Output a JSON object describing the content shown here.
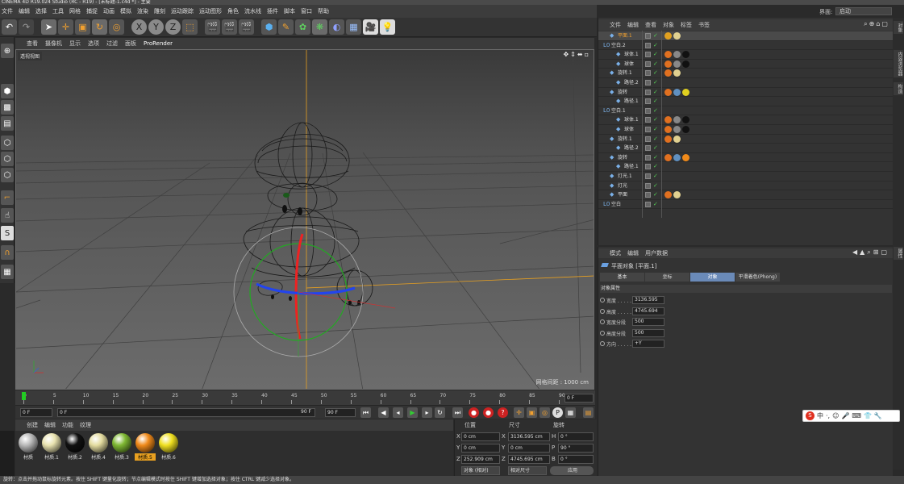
{
  "window": {
    "title": "CINEMA 4D R19.024 Studio (RC - R19) - [未标题-1.c4d *] - 主要"
  },
  "menu": [
    "文件",
    "编辑",
    "选择",
    "工具",
    "网格",
    "捕捉",
    "动画",
    "模拟",
    "渲染",
    "雕刻",
    "运动跟踪",
    "运动图形",
    "角色",
    "流水线",
    "插件",
    "脚本",
    "窗口",
    "帮助"
  ],
  "layout": {
    "label": "界面:",
    "value": "启动"
  },
  "viewport": {
    "menu": [
      "查看",
      "摄像机",
      "显示",
      "选项",
      "过滤",
      "面板",
      "ProRender"
    ],
    "name": "透视视图",
    "grid_info": "网格间距 : 1000 cm",
    "nav_icons": "✥⇕⬌▫"
  },
  "timeline": {
    "ticks": [
      "0",
      "5",
      "10",
      "15",
      "20",
      "25",
      "30",
      "35",
      "40",
      "45",
      "50",
      "55",
      "60",
      "65",
      "70",
      "75",
      "80",
      "85",
      "90"
    ],
    "end_frame_display": "0 F",
    "current_frame": "0 F",
    "start": "0 F",
    "range_end": "90 F",
    "max": "90 F"
  },
  "material_menu": [
    "创建",
    "编辑",
    "功能",
    "纹理"
  ],
  "materials": [
    {
      "name": "材质",
      "color": "#b9b9b9",
      "selected": false
    },
    {
      "name": "材质.1",
      "color": "#e9e3b0",
      "selected": false
    },
    {
      "name": "材质.2",
      "color": "#111111",
      "selected": false
    },
    {
      "name": "材质.4",
      "color": "#e4dca0",
      "selected": false
    },
    {
      "name": "材质.3",
      "color": "#7fb833",
      "selected": false
    },
    {
      "name": "材质.5",
      "color": "#f08a1a",
      "selected": true
    },
    {
      "name": "材质.6",
      "color": "#f0e020",
      "selected": false
    }
  ],
  "coords": {
    "headers": [
      "位置",
      "尺寸",
      "旋转"
    ],
    "rows": [
      {
        "axis": "X",
        "pos": "0 cm",
        "size_axis": "X",
        "size": "3136.595 cm",
        "rot_axis": "H",
        "rot": "0 °"
      },
      {
        "axis": "Y",
        "pos": "0 cm",
        "size_axis": "Y",
        "size": "0 cm",
        "rot_axis": "P",
        "rot": "90 °"
      },
      {
        "axis": "Z",
        "pos": "252.909 cm",
        "size_axis": "Z",
        "size": "4745.695 cm",
        "rot_axis": "B",
        "rot": "0 °"
      }
    ],
    "mode": "对象 (相对)",
    "size_mode": "相对尺寸",
    "apply": "应用"
  },
  "objects": {
    "menu": [
      "文件",
      "编辑",
      "查看",
      "对象",
      "标签",
      "书签"
    ],
    "rows": [
      {
        "name": "平面.1",
        "indent": 1,
        "selected": true,
        "tags": [
          "#e0a020",
          "#e0d090"
        ]
      },
      {
        "name": "空白.2",
        "indent": 0,
        "selected": false,
        "tags": []
      },
      {
        "name": "球体.1",
        "indent": 2,
        "selected": false,
        "tags": [
          "#e07020",
          "#888888",
          "#111111"
        ]
      },
      {
        "name": "球体",
        "indent": 2,
        "selected": false,
        "tags": [
          "#e07020",
          "#888888",
          "#111111"
        ]
      },
      {
        "name": "旋转.1",
        "indent": 1,
        "selected": false,
        "tags": [
          "#e07020",
          "#e0d090"
        ]
      },
      {
        "name": "路径.2",
        "indent": 2,
        "selected": false,
        "tags": []
      },
      {
        "name": "旋转",
        "indent": 1,
        "selected": false,
        "tags": [
          "#e07020",
          "#6090c0",
          "#e0d020"
        ]
      },
      {
        "name": "路径.1",
        "indent": 2,
        "selected": false,
        "tags": []
      },
      {
        "name": "空白.1",
        "indent": 0,
        "selected": false,
        "tags": []
      },
      {
        "name": "球体.1",
        "indent": 2,
        "selected": false,
        "tags": [
          "#e07020",
          "#888888",
          "#111111"
        ]
      },
      {
        "name": "球体",
        "indent": 2,
        "selected": false,
        "tags": [
          "#e07020",
          "#888888",
          "#111111"
        ]
      },
      {
        "name": "旋转.1",
        "indent": 1,
        "selected": false,
        "tags": [
          "#e07020",
          "#e0d090"
        ]
      },
      {
        "name": "路径.2",
        "indent": 2,
        "selected": false,
        "tags": []
      },
      {
        "name": "旋转",
        "indent": 1,
        "selected": false,
        "tags": [
          "#e07020",
          "#6090c0",
          "#f08a1a"
        ]
      },
      {
        "name": "路径.1",
        "indent": 2,
        "selected": false,
        "tags": []
      },
      {
        "name": "灯光.1",
        "indent": 1,
        "selected": false,
        "tags": []
      },
      {
        "name": "灯光",
        "indent": 1,
        "selected": false,
        "tags": []
      },
      {
        "name": "平面",
        "indent": 1,
        "selected": false,
        "tags": [
          "#e07020",
          "#e0d090"
        ]
      },
      {
        "name": "空白",
        "indent": 0,
        "selected": false,
        "tags": []
      }
    ]
  },
  "attributes": {
    "menu": [
      "模式",
      "编辑",
      "用户数据"
    ],
    "object_title": "平面对象 [平面.1]",
    "tabs": [
      "基本",
      "坐标",
      "对象",
      "平滑着色(Phong)"
    ],
    "active_tab": "对象",
    "section": "对象属性",
    "fields": [
      {
        "label": "宽度 . . . . .",
        "value": "3136.595"
      },
      {
        "label": "高度 . . . . .",
        "value": "4745.694"
      },
      {
        "label": "宽度分段",
        "value": "500"
      },
      {
        "label": "高度分段",
        "value": "500"
      },
      {
        "label": "方向 . . . . .",
        "value": "+Y"
      }
    ]
  },
  "right_strip": [
    "对象",
    "内容浏览器",
    "构造",
    "属性"
  ],
  "ime": [
    "S",
    "中",
    "·,",
    "☺",
    "🎤",
    "⌨",
    "👕",
    "🔧"
  ],
  "status": "旋转：点击并拖动鼠标旋转元素。按住 SHIFT 键量化旋转；节点编辑模式时按住 SHIFT 键增加选择对象；按住 CTRL 键减少选择对象。",
  "colors": {
    "accent": "#f0a030",
    "active_tab": "#6a8ab8",
    "frame_marker": "#22cc22"
  }
}
